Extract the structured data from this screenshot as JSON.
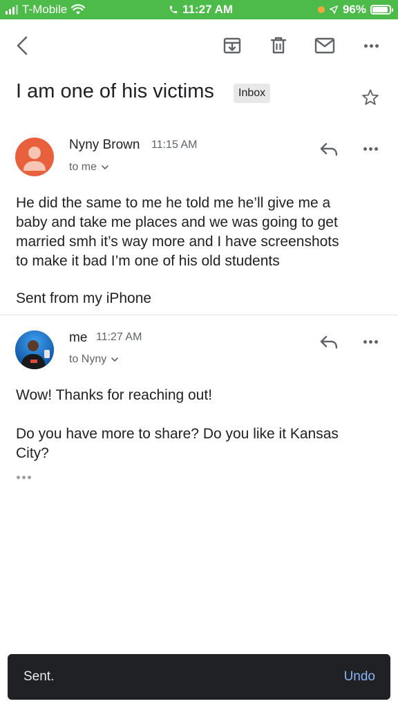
{
  "status_bar": {
    "carrier": "T-Mobile",
    "time": "11:27 AM",
    "battery": "96%"
  },
  "toolbar": {
    "back": "back-arrow-icon",
    "archive": "archive-icon",
    "delete": "trash-icon",
    "mark_unread": "mail-icon",
    "more": "more-horizontal-icon"
  },
  "thread": {
    "subject": "I am one of his victims",
    "label": "Inbox"
  },
  "messages": [
    {
      "sender": "Nyny Brown",
      "time": "11:15 AM",
      "recipients": "to me",
      "body_lines": [
        "He did the same to me he told me he’ll give me a",
        "baby and take me places and we was going to get",
        "married smh it’s way more and I have screenshots",
        "to make it bad I’m one of his old students"
      ],
      "signature": "Sent from my iPhone",
      "avatar_color": "#e8613c"
    },
    {
      "sender": "me",
      "time": "11:27 AM",
      "recipients": "to Nyny",
      "body_lines": [
        "Wow! Thanks for reaching out!",
        "",
        "Do you have more to share? Do you like it Kansas",
        "City?"
      ]
    }
  ],
  "snackbar": {
    "message": "Sent.",
    "action": "Undo"
  },
  "colors": {
    "status_bar": "#4cbb4a",
    "snackbar_bg": "#202124",
    "undo": "#8ab4f8",
    "avatar_orange": "#e8613c"
  }
}
